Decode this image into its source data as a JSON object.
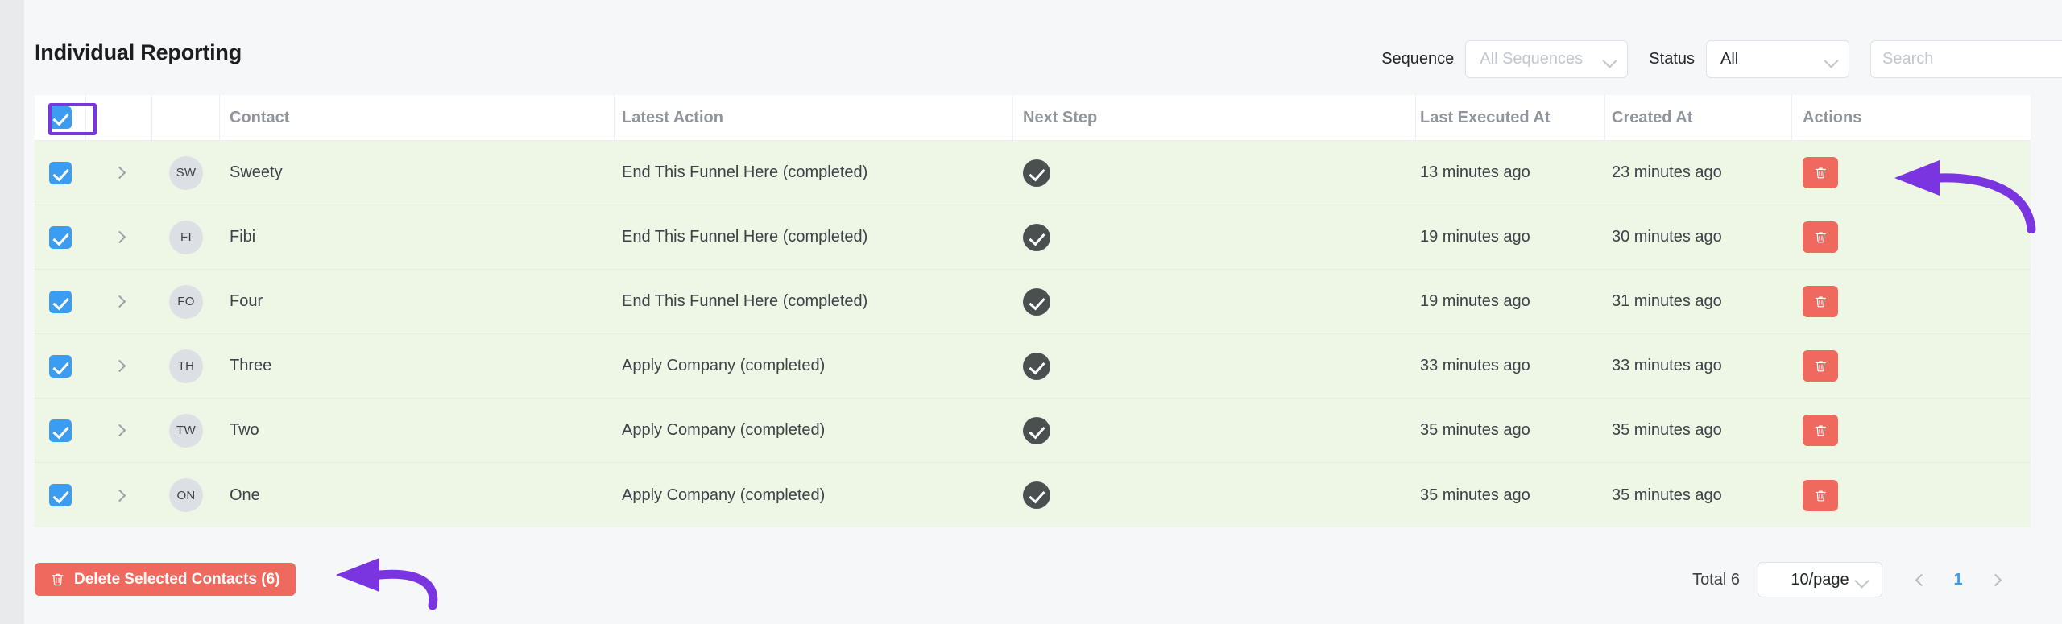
{
  "header": {
    "title": "Individual Reporting",
    "sequence_label": "Sequence",
    "sequence_value": "All Sequences",
    "status_label": "Status",
    "status_value": "All",
    "search_placeholder": "Search",
    "search_value": ""
  },
  "table": {
    "columns": [
      "",
      "",
      "",
      "Contact",
      "Latest Action",
      "Next Step",
      "Last Executed At",
      "Created At",
      "Actions"
    ],
    "header_select_all_checked": true,
    "rows": [
      {
        "checked": true,
        "initials": "SW",
        "contact": "Sweety",
        "latest_action": "End This Funnel Here (completed)",
        "next_step_status": "completed-check",
        "last_executed_at": "13 minutes ago",
        "created_at": "23 minutes ago"
      },
      {
        "checked": true,
        "initials": "FI",
        "contact": "Fibi",
        "latest_action": "End This Funnel Here (completed)",
        "next_step_status": "completed-check",
        "last_executed_at": "19 minutes ago",
        "created_at": "30 minutes ago"
      },
      {
        "checked": true,
        "initials": "FO",
        "contact": "Four",
        "latest_action": "End This Funnel Here (completed)",
        "next_step_status": "completed-check",
        "last_executed_at": "19 minutes ago",
        "created_at": "31 minutes ago"
      },
      {
        "checked": true,
        "initials": "TH",
        "contact": "Three",
        "latest_action": "Apply Company (completed)",
        "next_step_status": "completed-check",
        "last_executed_at": "33 minutes ago",
        "created_at": "33 minutes ago"
      },
      {
        "checked": true,
        "initials": "TW",
        "contact": "Two",
        "latest_action": "Apply Company (completed)",
        "next_step_status": "completed-check",
        "last_executed_at": "35 minutes ago",
        "created_at": "35 minutes ago"
      },
      {
        "checked": true,
        "initials": "ON",
        "contact": "One",
        "latest_action": "Apply Company (completed)",
        "next_step_status": "completed-check",
        "last_executed_at": "35 minutes ago",
        "created_at": "35 minutes ago"
      }
    ]
  },
  "footer": {
    "delete_selected_label": "Delete Selected Contacts (6)",
    "total_label": "Total 6",
    "page_size": "10/page",
    "current_page": "1"
  },
  "colors": {
    "accent_blue": "#3c9cf0",
    "danger_red": "#f0695f",
    "annotation_purple": "#7a35e0",
    "selected_row_green": "#eef7e6",
    "page_bg": "#f5f7f9"
  }
}
